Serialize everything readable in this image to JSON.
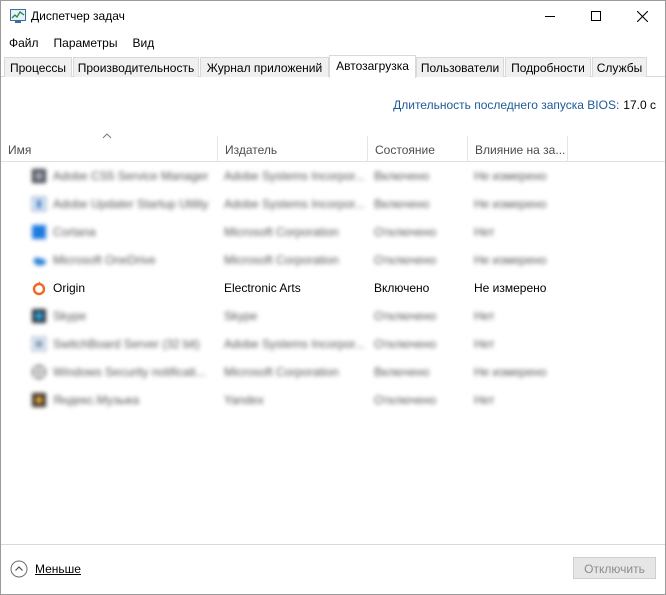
{
  "window": {
    "title": "Диспетчер задач",
    "controls": [
      "minimize",
      "maximize",
      "close"
    ]
  },
  "menu": [
    "Файл",
    "Параметры",
    "Вид"
  ],
  "tabs": [
    {
      "label": "Процессы"
    },
    {
      "label": "Производительность"
    },
    {
      "label": "Журнал приложений"
    },
    {
      "label": "Автозагрузка",
      "active": true
    },
    {
      "label": "Пользователи"
    },
    {
      "label": "Подробности"
    },
    {
      "label": "Службы"
    }
  ],
  "bios": {
    "label": "Длительность последнего запуска BIOS:",
    "value": "17.0 с"
  },
  "table": {
    "columns": [
      "Имя",
      "Издатель",
      "Состояние",
      "Влияние на за..."
    ],
    "sorted_column": "Имя",
    "rows": [
      {
        "name": "Adobe CS5 Service Manager",
        "publisher": "Adobe Systems Incorpor...",
        "status": "Включено",
        "impact": "Не измерено",
        "icon": "adobe-icon",
        "blurred": true
      },
      {
        "name": "Adobe Updater Startup Utility",
        "publisher": "Adobe Systems Incorpor...",
        "status": "Включено",
        "impact": "Не измерено",
        "icon": "updater-icon",
        "blurred": true
      },
      {
        "name": "Cortana",
        "publisher": "Microsoft Corporation",
        "status": "Отключено",
        "impact": "Нет",
        "icon": "cortana-icon",
        "blurred": true
      },
      {
        "name": "Microsoft OneDrive",
        "publisher": "Microsoft Corporation",
        "status": "Отключено",
        "impact": "Не измерено",
        "icon": "onedrive-icon",
        "blurred": true
      },
      {
        "name": "Origin",
        "publisher": "Electronic Arts",
        "status": "Включено",
        "impact": "Не измерено",
        "icon": "origin-icon",
        "blurred": false
      },
      {
        "name": "Skype",
        "publisher": "Skype",
        "status": "Отключено",
        "impact": "Нет",
        "icon": "skype-icon",
        "blurred": true
      },
      {
        "name": "SwitchBoard Server (32 bit)",
        "publisher": "Adobe Systems Incorpor...",
        "status": "Отключено",
        "impact": "Нет",
        "icon": "switchboard-icon",
        "blurred": true
      },
      {
        "name": "Windows Security notificati...",
        "publisher": "Microsoft Corporation",
        "status": "Включено",
        "impact": "Не измерено",
        "icon": "shield-icon",
        "blurred": true
      },
      {
        "name": "Яндекс.Музыка",
        "publisher": "Yandex",
        "status": "Отключено",
        "impact": "Нет",
        "icon": "yandex-music-icon",
        "blurred": true
      }
    ]
  },
  "footer": {
    "less_label": "Меньше",
    "disable_label": "Отключить",
    "disable_enabled": false
  },
  "colors": {
    "link": "#1e5a96",
    "origin_orange": "#f26722",
    "button_disabled_bg": "#e6e6e6"
  }
}
